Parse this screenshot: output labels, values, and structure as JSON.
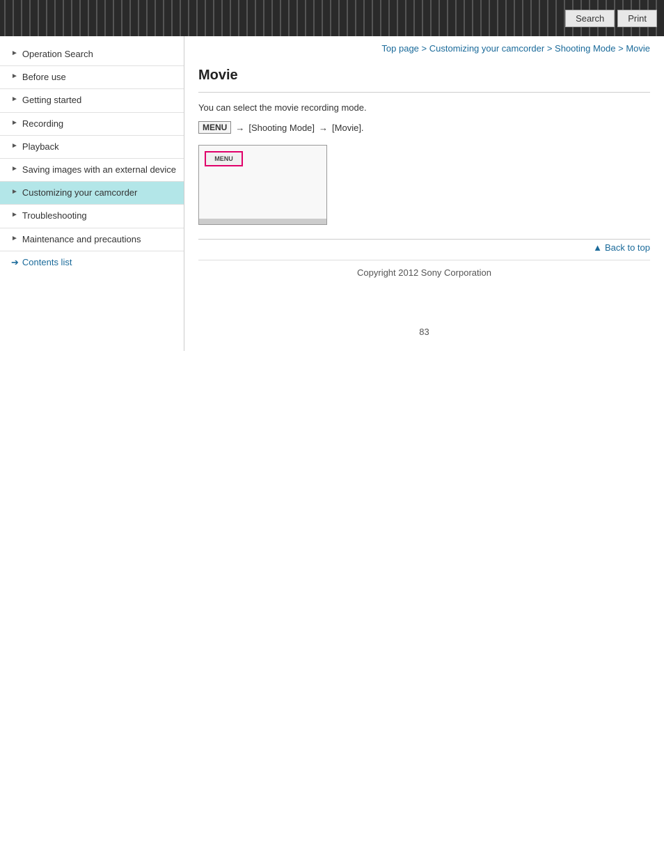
{
  "header": {
    "search_label": "Search",
    "print_label": "Print"
  },
  "breadcrumb": {
    "items": [
      {
        "text": "Top page",
        "link": true
      },
      {
        "text": " > ",
        "link": false
      },
      {
        "text": "Customizing your camcorder",
        "link": true
      },
      {
        "text": " > ",
        "link": false
      },
      {
        "text": "Shooting Mode",
        "link": true
      },
      {
        "text": " > ",
        "link": false
      },
      {
        "text": "Movie",
        "link": true
      }
    ]
  },
  "sidebar": {
    "items": [
      {
        "label": "Operation Search",
        "active": false
      },
      {
        "label": "Before use",
        "active": false
      },
      {
        "label": "Getting started",
        "active": false
      },
      {
        "label": "Recording",
        "active": false
      },
      {
        "label": "Playback",
        "active": false
      },
      {
        "label": "Saving images with an external device",
        "active": false
      },
      {
        "label": "Customizing your camcorder",
        "active": true
      },
      {
        "label": "Troubleshooting",
        "active": false
      },
      {
        "label": "Maintenance and precautions",
        "active": false
      }
    ],
    "contents_list_label": "Contents list"
  },
  "main": {
    "page_title": "Movie",
    "description": "You can select the movie recording mode.",
    "instruction": {
      "menu_key": "MENU",
      "arrow1": "→",
      "shooting_mode": "[Shooting Mode]",
      "arrow2": "→",
      "movie": "[Movie]."
    },
    "camera_preview_label": "MENU",
    "back_to_top": "Back to top"
  },
  "footer": {
    "copyright": "Copyright 2012 Sony Corporation",
    "page_number": "83"
  }
}
